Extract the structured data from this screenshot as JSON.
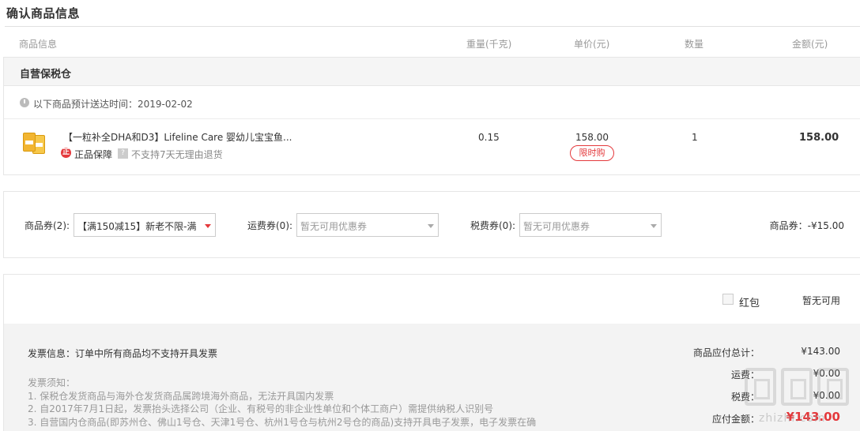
{
  "page_title": "确认商品信息",
  "columns": {
    "product": "商品信息",
    "weight": "重量(千克)",
    "unit_price": "单价(元)",
    "quantity": "数量",
    "amount": "金额(元)"
  },
  "warehouse": {
    "name": "自营保税仓",
    "eta_text": "以下商品预计送达时间：2019-02-02"
  },
  "item": {
    "name": "【一粒补全DHA和D3】Lifeline Care 婴幼儿宝宝鱼...",
    "guarantee": "正品保障",
    "guarantee_icon_glyph": "正",
    "return_icon_glyph": "?",
    "return_policy": "不支持7天无理由退货",
    "weight": "0.15",
    "price": "158.00",
    "limited_badge": "限时购",
    "quantity": "1",
    "amount": "158.00"
  },
  "coupons": {
    "product_label": "商品券(2):",
    "product_value": "【满150减15】新老不限-满...",
    "shipping_label": "运费券(0):",
    "shipping_placeholder": "暂无可用优惠券",
    "tax_label": "税费券(0):",
    "tax_placeholder": "暂无可用优惠券",
    "summary": "商品券：-¥15.00"
  },
  "red_packet": {
    "label": "红包",
    "status": "暂无可用"
  },
  "invoice": {
    "info": "发票信息：订单中所有商品均不支持开具发票",
    "notice_title": "发票须知：",
    "notices": [
      "1. 保税仓发货商品与海外仓发货商品属跨境海外商品，无法开具国内发票",
      "2. 自2017年7月1日起，发票抬头选择公司（企业、有税号的非企业性单位和个体工商户）需提供纳税人识别号",
      "3. 自营国内仓商品(即苏州仓、佛山1号仓、天津1号仓、杭州1号仓与杭州2号仓的商品)支持开具电子发票，电子发票在确"
    ]
  },
  "summary": {
    "subtotal_label": "商品应付总计：",
    "subtotal_value": "¥143.00",
    "shipping_label": "运费：",
    "shipping_value": "¥0.00",
    "tax_label": "税费：",
    "tax_value": "¥0.00",
    "payable_label": "应付金额：",
    "payable_value": "¥143.00"
  },
  "watermark": "zhizhi.com",
  "colors": {
    "accent_red": "#e4393c",
    "muted_gray": "#999999",
    "panel_bg": "#f3f3f3"
  }
}
